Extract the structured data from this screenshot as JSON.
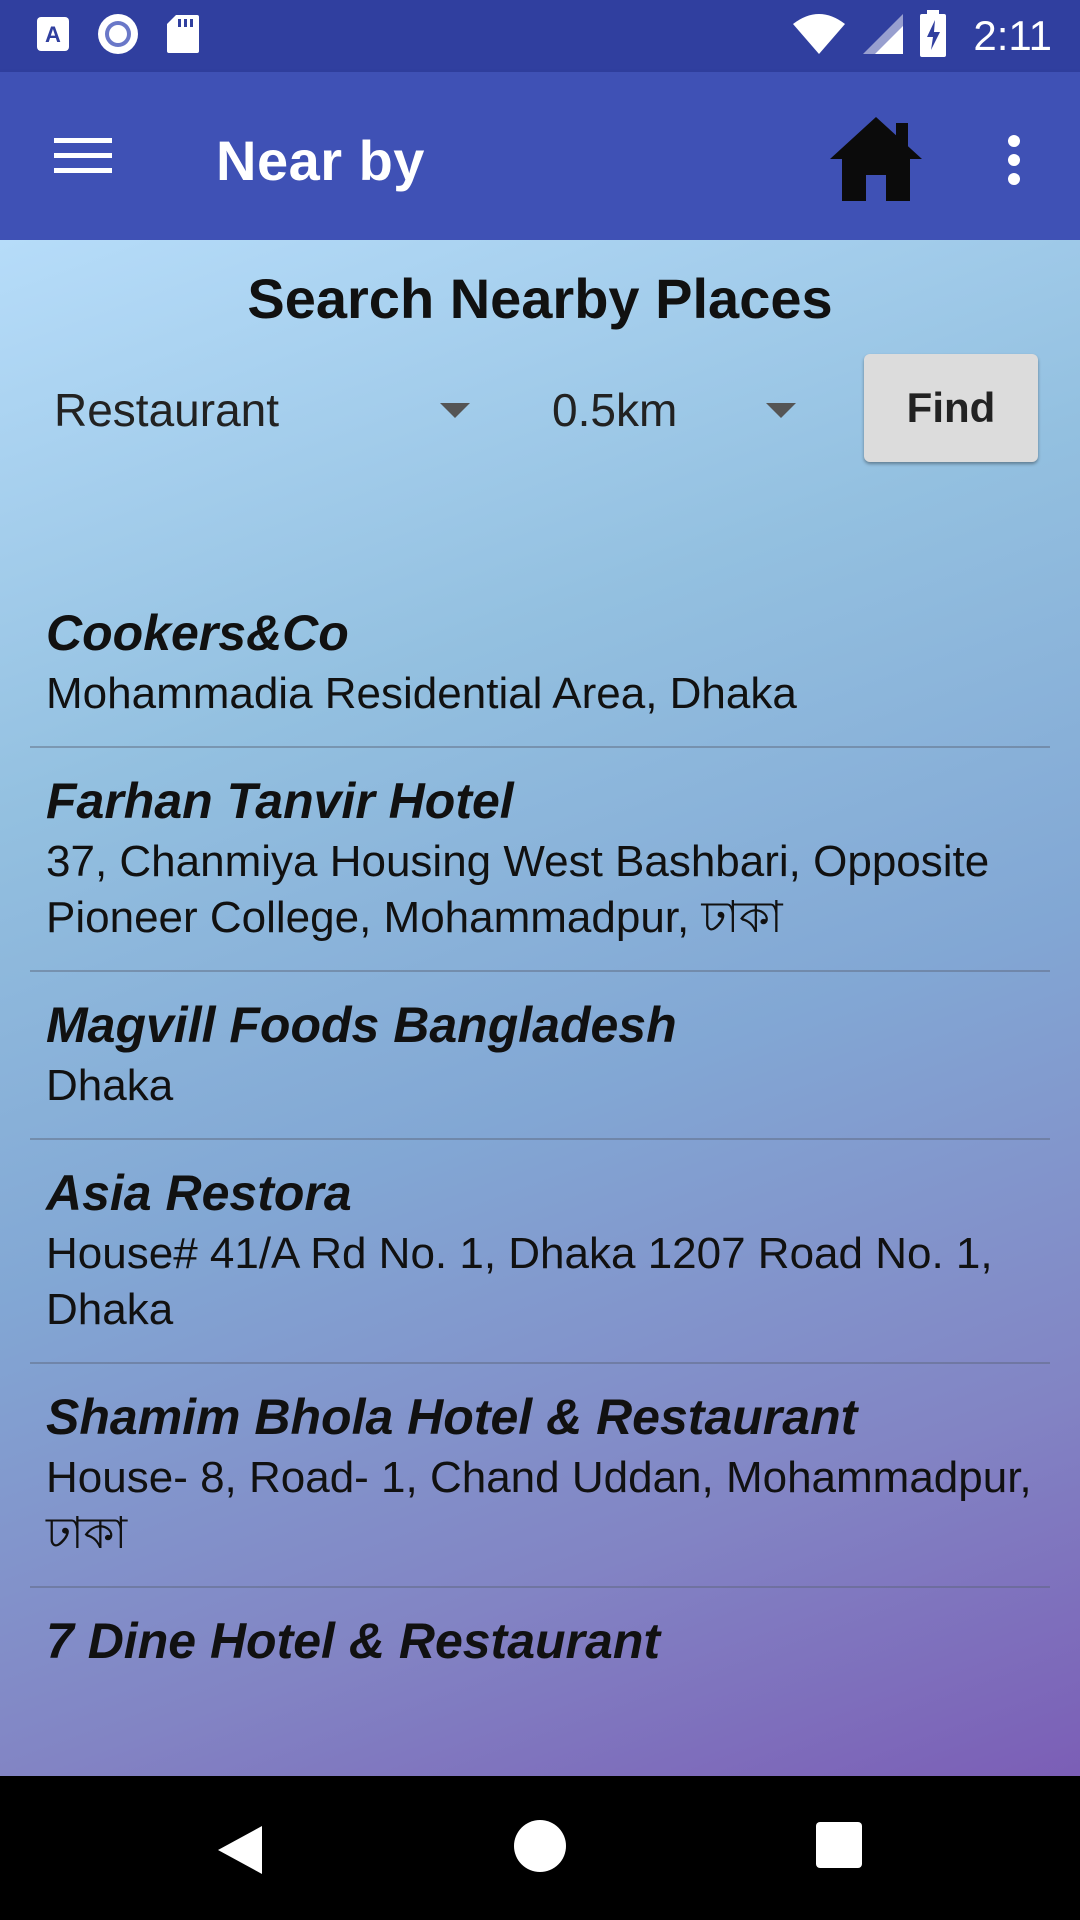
{
  "status_bar": {
    "time": "2:11",
    "icons": [
      "text-a-icon",
      "record-circle-icon",
      "sd-card-icon",
      "wifi-icon",
      "signal-icon",
      "battery-charging-icon"
    ]
  },
  "app_bar": {
    "title": "Near by",
    "icons": [
      "hamburger-menu-icon",
      "home-icon",
      "more-vert-icon"
    ]
  },
  "search": {
    "heading": "Search Nearby Places",
    "type_value": "Restaurant",
    "distance_value": "0.5km",
    "find_label": "Find"
  },
  "places": [
    {
      "name": "Cookers&Co",
      "address": "Mohammadia Residential Area, Dhaka"
    },
    {
      "name": "Farhan Tanvir Hotel",
      "address": "37, Chanmiya Housing West Bashbari, Opposite Pioneer College, Mohammadpur, ঢাকা"
    },
    {
      "name": "Magvill Foods Bangladesh",
      "address": "Dhaka"
    },
    {
      "name": "Asia Restora",
      "address": "House# 41/A Rd No. 1, Dhaka 1207 Road No. 1, Dhaka"
    },
    {
      "name": "Shamim Bhola Hotel & Restaurant",
      "address": "House- 8, Road- 1, Chand Uddan, Mohammadpur, ঢাকা"
    },
    {
      "name": "7 Dine Hotel & Restaurant",
      "address": ""
    }
  ],
  "colors": {
    "status_bar": "#303f9f",
    "app_bar": "#3f51b5",
    "gradient_top": "#b6dcf9",
    "gradient_bottom": "#7b5eb6"
  }
}
